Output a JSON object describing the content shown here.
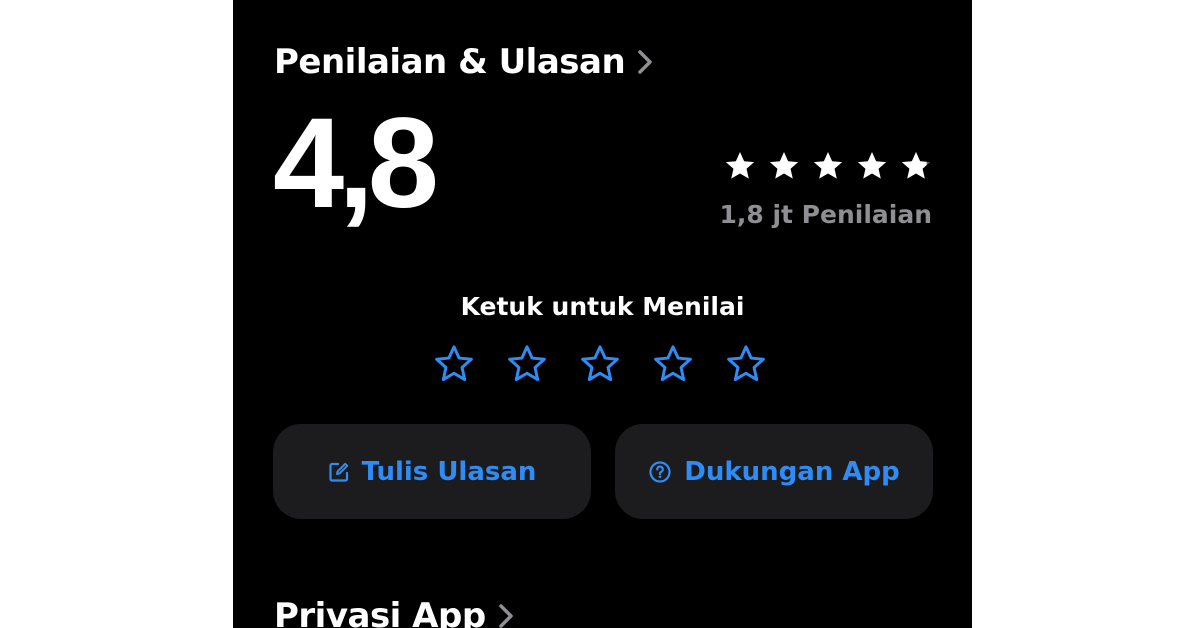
{
  "ratings_section": {
    "title": "Penilaian & Ulasan",
    "average": "4,8",
    "stars_filled": 4.8,
    "rating_count": "1,8 jt Penilaian"
  },
  "tap_to_rate": {
    "label": "Ketuk untuk Menilai",
    "stars": 5
  },
  "buttons": {
    "write_review": {
      "label": "Tulis Ulasan",
      "icon": "compose-icon"
    },
    "app_support": {
      "label": "Dukungan App",
      "icon": "question-circle-icon"
    }
  },
  "privacy_section": {
    "title": "Privasi App"
  },
  "colors": {
    "background": "#000000",
    "accent": "#2f8cf5",
    "button_bg": "#1c1c1e",
    "secondary_text": "#8e8e93",
    "primary_text": "#ffffff"
  }
}
